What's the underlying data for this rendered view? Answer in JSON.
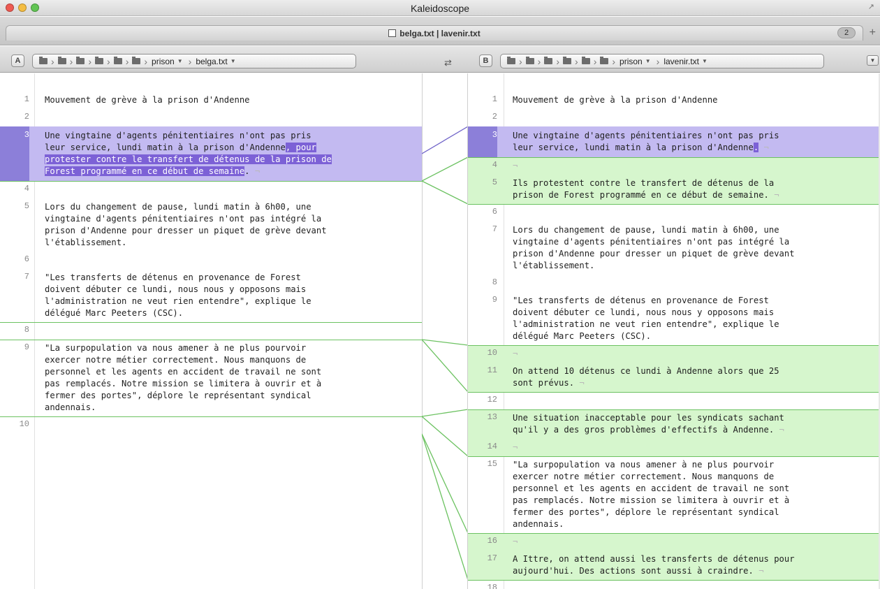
{
  "window": {
    "title": "Kaleidoscope"
  },
  "tab": {
    "title": "belga.txt | lavenir.txt",
    "count": "2",
    "add": "+"
  },
  "left_path": {
    "pane_label": "A",
    "folder_count": 6,
    "folder": "prison",
    "file": "belga.txt"
  },
  "right_path": {
    "pane_label": "B",
    "folder_count": 6,
    "folder": "prison",
    "file": "lavenir.txt"
  },
  "colors": {
    "change": "#c3baf1",
    "change_gutter": "#8c7fd9",
    "change_highlight": "#7c61d6",
    "insert": "#d6f6cd",
    "connector": "#6cc261",
    "change_connector": "#6f63c8"
  },
  "left_lines": [
    {
      "n": "1",
      "text": "Mouvement de grève à la prison d'Andenne"
    },
    {
      "n": "2",
      "text": ""
    },
    {
      "n": "3",
      "type": "change",
      "text": "Une vingtaine d'agents pénitentiaires n'ont pas pris\nleur service, lundi matin à la prison d'Andenne",
      "hl": ", pour\nprotester contre le transfert de détenus de la prison de\nForest programmé en ce début de semaine",
      "after": "."
    },
    {
      "n": "4",
      "text": ""
    },
    {
      "n": "5",
      "text": "Lors du changement de pause, lundi matin à 6h00, une\nvingtaine d'agents pénitentiaires n'ont pas intégré la\nprison d'Andenne pour dresser un piquet de grève devant\nl'établissement."
    },
    {
      "n": "6",
      "text": ""
    },
    {
      "n": "7",
      "text": "\"Les transferts de détenus en provenance de Forest\ndoivent débuter ce lundi, nous nous y opposons mais\nl'administration ne veut rien entendre\", explique le\ndélégué Marc Peeters (CSC)."
    },
    {
      "n": "8",
      "text": ""
    },
    {
      "n": "9",
      "text": "\"La surpopulation va nous amener à ne plus pourvoir\nexercer notre métier correctement. Nous manquons de\npersonnel et les agents en accident de travail ne sont\npas remplacés. Notre mission se limitera à ouvrir et à\nfermer des portes\", déplore le représentant syndical\nandennais."
    },
    {
      "n": "10",
      "text": ""
    }
  ],
  "right_lines": [
    {
      "n": "1",
      "text": "Mouvement de grève à la prison d'Andenne"
    },
    {
      "n": "2",
      "text": ""
    },
    {
      "n": "3",
      "type": "change",
      "text": "Une vingtaine d'agents pénitentiaires n'ont pas pris\nleur service, lundi matin à la prison d'Andenne",
      "hl": ".",
      "after": ""
    },
    {
      "n": "4",
      "type": "insert",
      "text": ""
    },
    {
      "n": "5",
      "type": "insert",
      "text": "Ils protestent contre le transfert de détenus de la\nprison de Forest programmé en ce début de semaine."
    },
    {
      "n": "6",
      "text": ""
    },
    {
      "n": "7",
      "text": "Lors du changement de pause, lundi matin à 6h00, une\nvingtaine d'agents pénitentiaires n'ont pas intégré la\nprison d'Andenne pour dresser un piquet de grève devant\nl'établissement."
    },
    {
      "n": "8",
      "text": ""
    },
    {
      "n": "9",
      "text": "\"Les transferts de détenus en provenance de Forest\ndoivent débuter ce lundi, nous nous y opposons mais\nl'administration ne veut rien entendre\", explique le\ndélégué Marc Peeters (CSC)."
    },
    {
      "n": "10",
      "type": "insert",
      "text": ""
    },
    {
      "n": "11",
      "type": "insert",
      "text": "On attend 10 détenus ce lundi à Andenne alors que 25\nsont prévus."
    },
    {
      "n": "12",
      "text": ""
    },
    {
      "n": "13",
      "type": "insert",
      "text": "Une situation inacceptable pour les syndicats sachant\nqu'il y a des gros problèmes d'effectifs à Andenne."
    },
    {
      "n": "14",
      "type": "insert",
      "text": ""
    },
    {
      "n": "15",
      "text": "\"La surpopulation va nous amener à ne plus pourvoir\nexercer notre métier correctement. Nous manquons de\npersonnel et les agents en accident de travail ne sont\npas remplacés. Notre mission se limitera à ouvrir et à\nfermer des portes\", déplore le représentant syndical\nandennais."
    },
    {
      "n": "16",
      "type": "insert",
      "text": ""
    },
    {
      "n": "17",
      "type": "insert",
      "text": "A Ittre, on attend aussi les transferts de détenus pour\naujourd'hui. Des actions sont aussi à craindre."
    },
    {
      "n": "18",
      "text": ""
    }
  ]
}
